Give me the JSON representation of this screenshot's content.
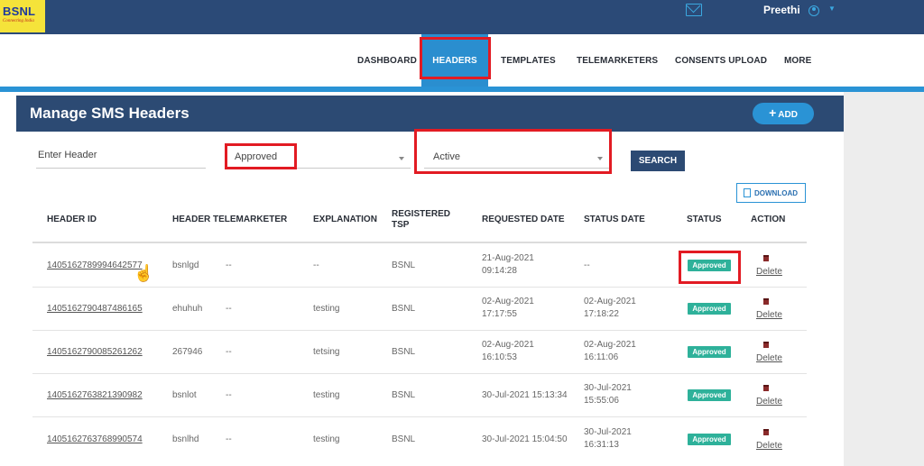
{
  "brand": {
    "name": "BSNL",
    "tagline": "Connecting India"
  },
  "topbar": {
    "user_name": "Preethi",
    "mail_icon": "mail-icon",
    "user_icon": "user-circle-icon"
  },
  "nav": {
    "items": [
      {
        "label": "DASHBOARD"
      },
      {
        "label": "HEADERS",
        "active": true
      },
      {
        "label": "TEMPLATES"
      },
      {
        "label": "TELEMARKETERS"
      },
      {
        "label": "CONSENTS UPLOAD"
      },
      {
        "label": "MORE"
      }
    ]
  },
  "page": {
    "title": "Manage SMS Headers",
    "add_label": "ADD"
  },
  "filters": {
    "header_placeholder": "Enter Header",
    "status_value": "Approved",
    "state_value": "Active",
    "search_label": "SEARCH",
    "download_label": "DOWNLOAD"
  },
  "table": {
    "columns": [
      "HEADER ID",
      "HEADER",
      "TELEMARKETER",
      "EXPLANATION",
      "REGISTERED TSP",
      "REQUESTED DATE",
      "STATUS DATE",
      "STATUS",
      "ACTION"
    ],
    "rows": [
      {
        "header_id": "1405162789994642577",
        "header": "bsnlgd",
        "telemarketer": "--",
        "explanation": "--",
        "tsp": "BSNL",
        "requested_date": "21-Aug-2021",
        "requested_time": "09:14:28",
        "status_date": "--",
        "status_time": "",
        "status": "Approved",
        "action": "Delete"
      },
      {
        "header_id": "1405162790487486165",
        "header": "ehuhuh",
        "telemarketer": "--",
        "explanation": "testing",
        "tsp": "BSNL",
        "requested_date": "02-Aug-2021",
        "requested_time": "17:17:55",
        "status_date": "02-Aug-2021",
        "status_time": "17:18:22",
        "status": "Approved",
        "action": "Delete"
      },
      {
        "header_id": "1405162790085261262",
        "header": "267946",
        "telemarketer": "--",
        "explanation": "tetsing",
        "tsp": "BSNL",
        "requested_date": "02-Aug-2021",
        "requested_time": "16:10:53",
        "status_date": "02-Aug-2021",
        "status_time": "16:11:06",
        "status": "Approved",
        "action": "Delete"
      },
      {
        "header_id": "1405162763821390982",
        "header": "bsnlot",
        "telemarketer": "--",
        "explanation": "testing",
        "tsp": "BSNL",
        "requested_date": "30-Jul-2021 15:13:34",
        "requested_time": "",
        "status_date": "30-Jul-2021",
        "status_time": "15:55:06",
        "status": "Approved",
        "action": "Delete"
      },
      {
        "header_id": "1405162763768990574",
        "header": "bsnlhd",
        "telemarketer": "--",
        "explanation": "testing",
        "tsp": "BSNL",
        "requested_date": "30-Jul-2021 15:04:50",
        "requested_time": "",
        "status_date": "30-Jul-2021",
        "status_time": "16:31:13",
        "status": "Approved",
        "action": "Delete"
      }
    ]
  },
  "colors": {
    "topbar": "#2b4a77",
    "accent": "#2a93d5",
    "approved": "#2eb19a",
    "highlight": "#e21b23"
  }
}
